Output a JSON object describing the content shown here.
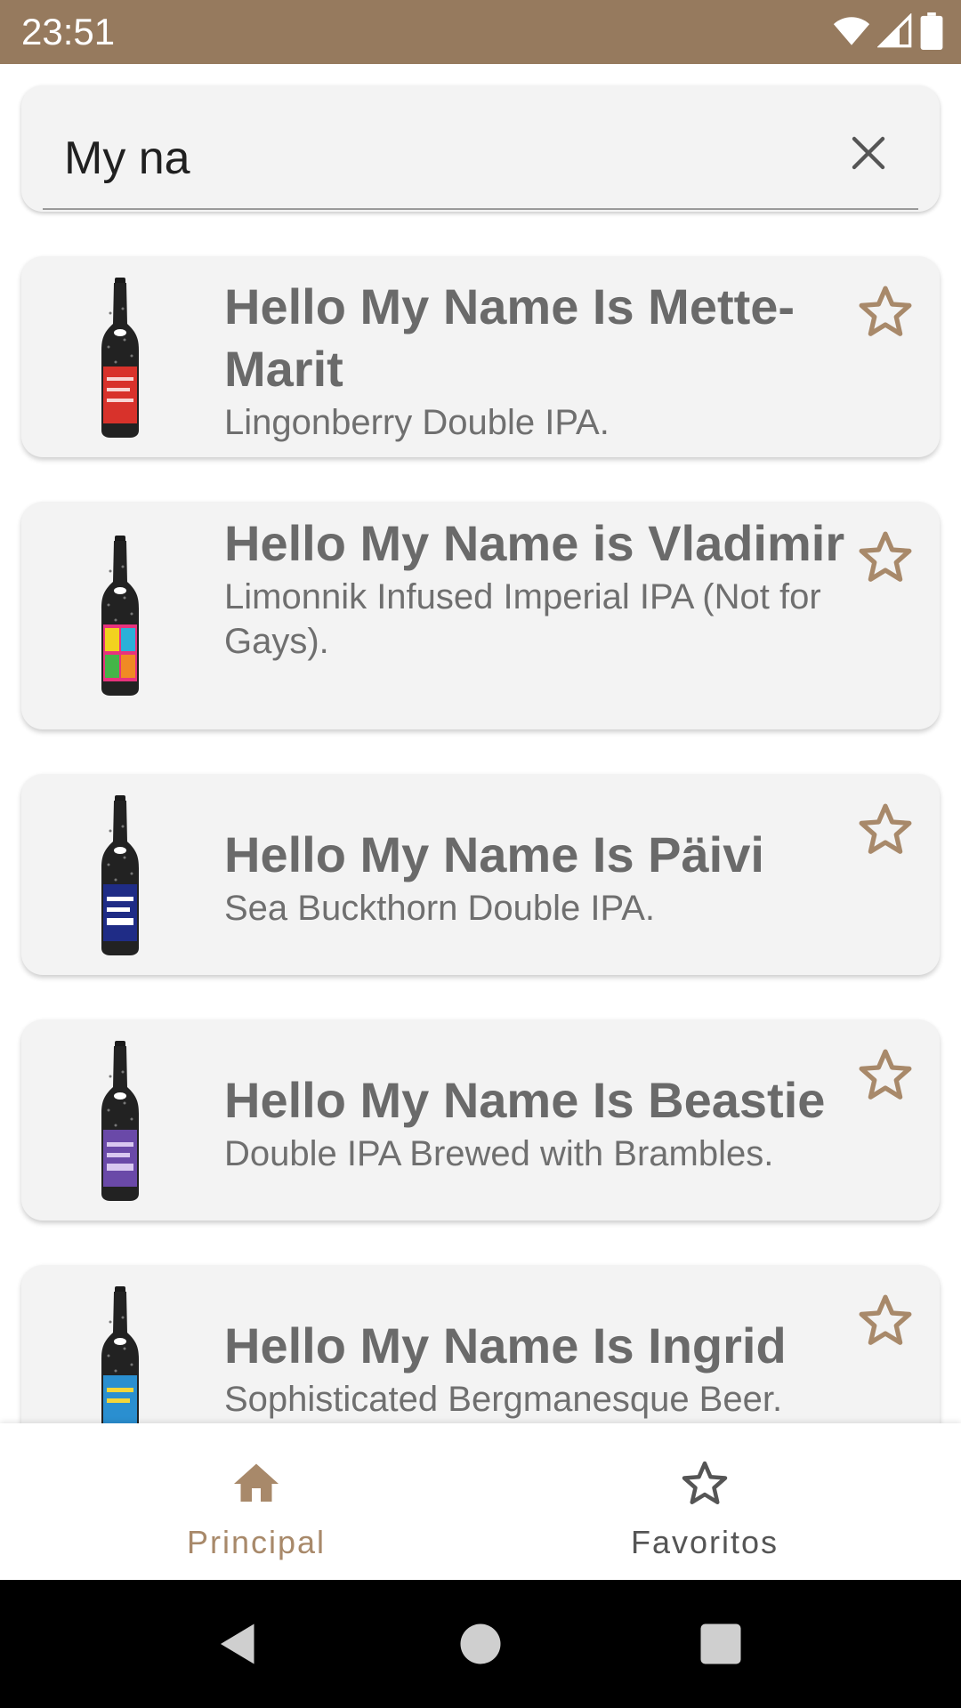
{
  "status_bar": {
    "time": "23:51",
    "background": "#967a5e"
  },
  "search": {
    "value": "My na",
    "clear_icon": "close-icon"
  },
  "beers": [
    {
      "name": "Hello My Name Is Mette-Marit",
      "tagline": "Lingonberry Double IPA.",
      "label_color": "#d8322b",
      "favorite": false
    },
    {
      "name": "Hello My Name is Vladimir",
      "tagline": "Limonnik Infused Imperial IPA (Not for Gays).",
      "label_color": "#e8327d",
      "favorite": false
    },
    {
      "name": "Hello My Name Is Päivi",
      "tagline": "Sea Buckthorn Double IPA.",
      "label_color": "#1f2c86",
      "favorite": false
    },
    {
      "name": "Hello My Name Is Beastie",
      "tagline": "Double IPA Brewed with Brambles.",
      "label_color": "#6a49a8",
      "favorite": false
    },
    {
      "name": "Hello My Name Is Ingrid",
      "tagline": "Sophisticated Bergmanesque Beer.",
      "label_color": "#2a8fd0",
      "favorite": false
    }
  ],
  "bottom_nav": {
    "items": [
      {
        "label": "Principal",
        "icon": "home-icon",
        "active": true
      },
      {
        "label": "Favoritos",
        "icon": "star-icon",
        "active": false
      }
    ],
    "active_color": "#a8896a",
    "inactive_color": "#555555"
  },
  "colors": {
    "accent": "#a8896a",
    "card_background": "#f3f3f3",
    "title_text": "#6a6a6a"
  }
}
